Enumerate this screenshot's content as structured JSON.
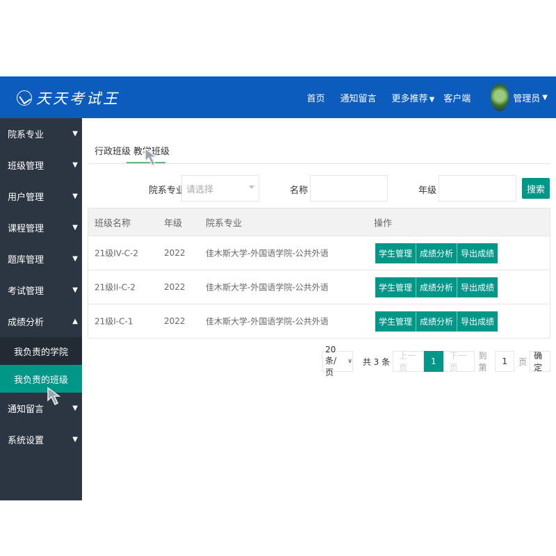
{
  "header": {
    "logo_text": "天天考试王",
    "nav": [
      "首页",
      "通知留言",
      "更多推荐",
      "客户端"
    ],
    "user_name": "管理员"
  },
  "sidebar": {
    "items": [
      "院系专业",
      "班级管理",
      "用户管理",
      "课程管理",
      "题库管理",
      "考试管理",
      "成绩分析"
    ],
    "sub_items": [
      "我负责的学院",
      "我负责的班级"
    ],
    "items_after": [
      "通知留言",
      "系统设置"
    ]
  },
  "tabs": [
    "行政班级",
    "教学班级"
  ],
  "filters": {
    "dept_label": "院系专业",
    "dept_placeholder": "请选择",
    "name_label": "名称",
    "grade_label": "年级",
    "search_label": "搜索"
  },
  "table": {
    "headers": [
      "班级名称",
      "年级",
      "院系专业",
      "操作"
    ],
    "rows": [
      {
        "name": "21级IV-C-2",
        "grade": "2022",
        "dept": "佳木斯大学-外国语学院-公共外语"
      },
      {
        "name": "21级II-C-2",
        "grade": "2022",
        "dept": "佳木斯大学-外国语学院-公共外语"
      },
      {
        "name": "21级I-C-1",
        "grade": "2022",
        "dept": "佳木斯大学-外国语学院-公共外语"
      }
    ],
    "actions": [
      "学生管理",
      "成绩分析",
      "导出成绩"
    ]
  },
  "pagination": {
    "page_size": "20条/页",
    "total_text": "共 3 条",
    "prev": "上一页",
    "current": "1",
    "next": "下一页",
    "goto_label": "到第",
    "goto_value": "1",
    "page_unit": "页",
    "confirm": "确定"
  }
}
